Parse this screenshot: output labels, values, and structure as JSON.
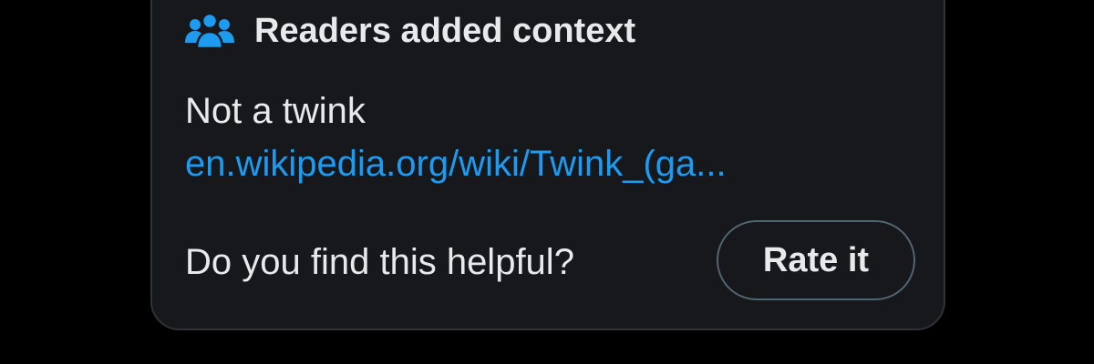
{
  "note": {
    "header_icon": "readers-group-icon",
    "title": "Readers added context",
    "text": "Not a twink",
    "link": "en.wikipedia.org/wiki/Twink_(ga...",
    "prompt": "Do you find this helpful?",
    "rate_label": "Rate it"
  },
  "colors": {
    "background": "#000000",
    "card": "#16181c",
    "border": "#2f3336",
    "text": "#e7e9ea",
    "link": "#1d9bf0",
    "button_border": "#536471"
  }
}
